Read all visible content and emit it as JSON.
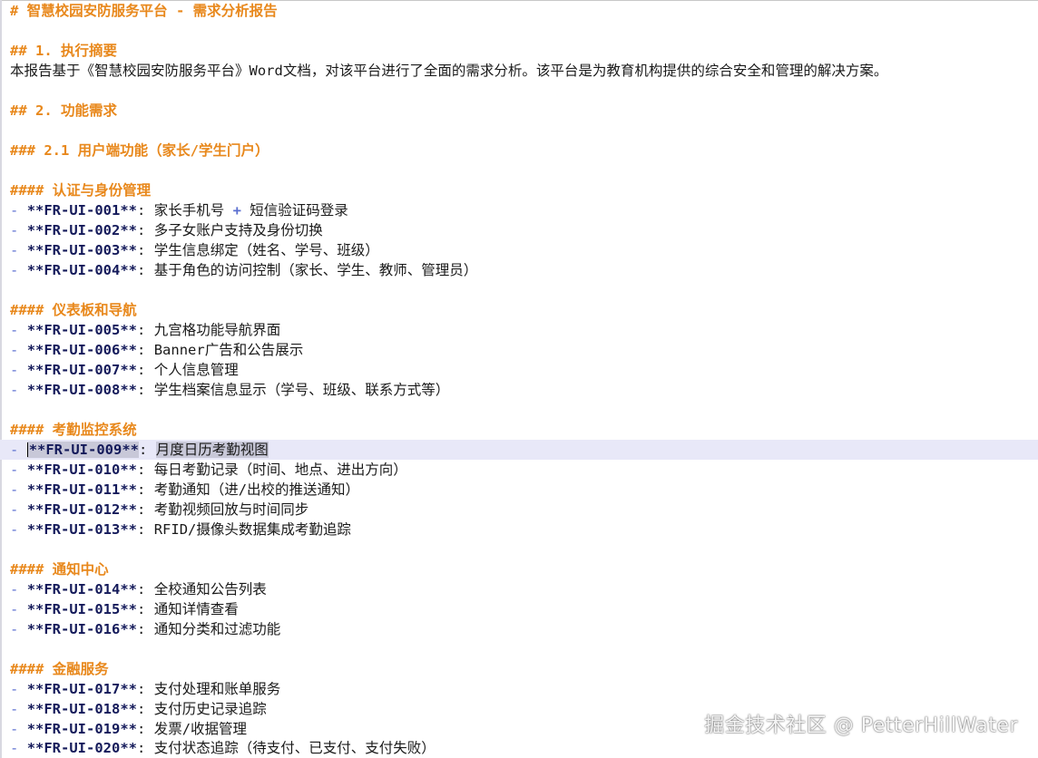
{
  "document": {
    "title_line": "# 智慧校园安防服务平台 - 需求分析报告",
    "h2_summary": "## 1. 执行摘要",
    "summary_text": "本报告基于《智慧校园安防服务平台》Word文档，对该平台进行了全面的需求分析。该平台是为教育机构提供的综合安全和管理的解决方案。",
    "h2_functional": "## 2. 功能需求",
    "h3_user": "### 2.1 用户端功能（家长/学生门户）",
    "sections": [
      {
        "heading": "#### 认证与身份管理",
        "items": [
          {
            "id": "**FR-UI-001**",
            "text_before": "家长手机号",
            "plus": "+",
            "text_after": "短信验证码登录"
          },
          {
            "id": "**FR-UI-002**",
            "text": "多子女账户支持及身份切换"
          },
          {
            "id": "**FR-UI-003**",
            "text": "学生信息绑定（姓名、学号、班级）"
          },
          {
            "id": "**FR-UI-004**",
            "text": "基于角色的访问控制（家长、学生、教师、管理员）"
          }
        ]
      },
      {
        "heading": "#### 仪表板和导航",
        "items": [
          {
            "id": "**FR-UI-005**",
            "text": "九宫格功能导航界面"
          },
          {
            "id": "**FR-UI-006**",
            "text": "Banner广告和公告展示"
          },
          {
            "id": "**FR-UI-007**",
            "text": "个人信息管理"
          },
          {
            "id": "**FR-UI-008**",
            "text": "学生档案信息显示（学号、班级、联系方式等）"
          }
        ]
      },
      {
        "heading": "#### 考勤监控系统",
        "items": [
          {
            "id": "**FR-UI-009**",
            "text": "月度日历考勤视图"
          },
          {
            "id": "**FR-UI-010**",
            "text": "每日考勤记录（时间、地点、进出方向）"
          },
          {
            "id": "**FR-UI-011**",
            "text": "考勤通知（进/出校的推送通知）"
          },
          {
            "id": "**FR-UI-012**",
            "text": "考勤视频回放与时间同步"
          },
          {
            "id": "**FR-UI-013**",
            "text": "RFID/摄像头数据集成考勤追踪"
          }
        ]
      },
      {
        "heading": "#### 通知中心",
        "items": [
          {
            "id": "**FR-UI-014**",
            "text": "全校通知公告列表"
          },
          {
            "id": "**FR-UI-015**",
            "text": "通知详情查看"
          },
          {
            "id": "**FR-UI-016**",
            "text": "通知分类和过滤功能"
          }
        ]
      },
      {
        "heading": "#### 金融服务",
        "items": [
          {
            "id": "**FR-UI-017**",
            "text": "支付处理和账单服务"
          },
          {
            "id": "**FR-UI-018**",
            "text": "支付历史记录追踪"
          },
          {
            "id": "**FR-UI-019**",
            "text": "发票/收据管理"
          },
          {
            "id": "**FR-UI-020**",
            "text": "支付状态追踪（待支付、已支付、支付失败）"
          }
        ]
      }
    ],
    "list_marker": "-",
    "id_suffix": ":"
  },
  "watermark": "掘金技术社区 @ PetterHillWater",
  "colors": {
    "heading": "#e8881c",
    "list_marker": "#5b6fd0",
    "requirement_id": "#141a5a",
    "current_line": "#e8e8f8"
  }
}
